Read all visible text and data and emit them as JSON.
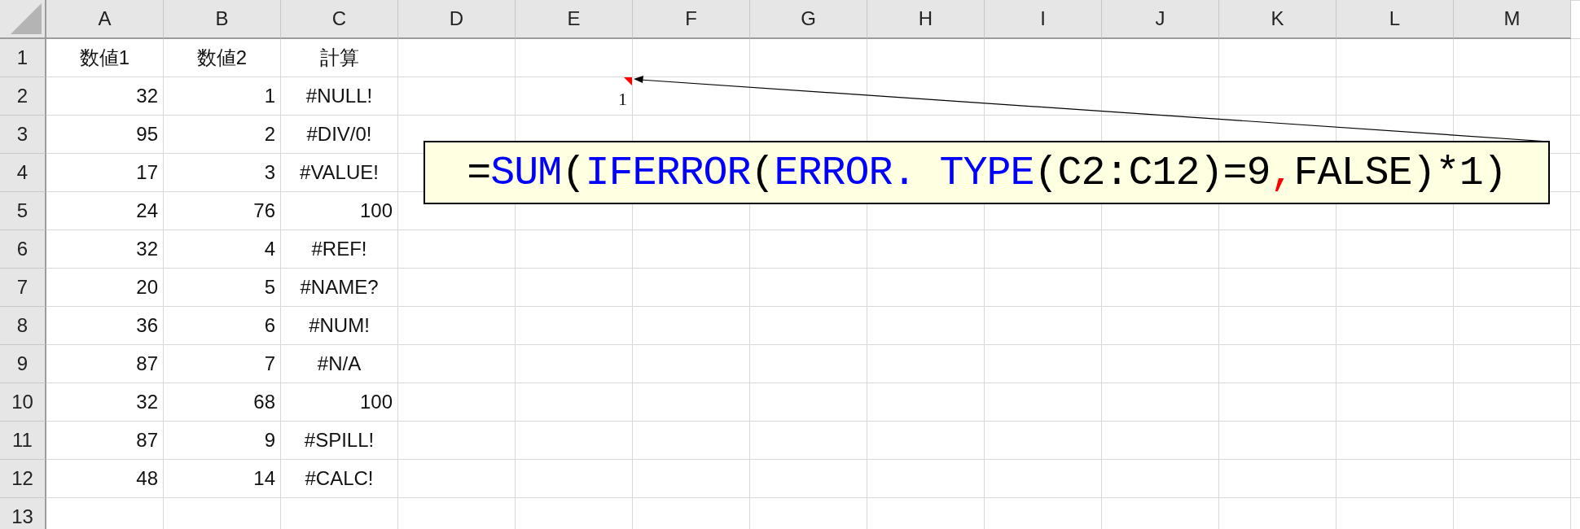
{
  "columns": [
    "A",
    "B",
    "C",
    "D",
    "E",
    "F",
    "G",
    "H",
    "I",
    "J",
    "K",
    "L",
    "M"
  ],
  "rows": [
    {
      "header": "1",
      "cells": [
        {
          "text": "数値1",
          "kind": "label"
        },
        {
          "text": "数値2",
          "kind": "label"
        },
        {
          "text": "計算",
          "kind": "label"
        }
      ]
    },
    {
      "header": "2",
      "cells": [
        {
          "text": "32",
          "kind": "number"
        },
        {
          "text": "1",
          "kind": "number"
        },
        {
          "text": "#NULL!",
          "kind": "error"
        }
      ]
    },
    {
      "header": "3",
      "cells": [
        {
          "text": "95",
          "kind": "number"
        },
        {
          "text": "2",
          "kind": "number"
        },
        {
          "text": "#DIV/0!",
          "kind": "error"
        }
      ]
    },
    {
      "header": "4",
      "cells": [
        {
          "text": "17",
          "kind": "number"
        },
        {
          "text": "3",
          "kind": "number"
        },
        {
          "text": "#VALUE!",
          "kind": "error"
        }
      ]
    },
    {
      "header": "5",
      "cells": [
        {
          "text": "24",
          "kind": "number"
        },
        {
          "text": "76",
          "kind": "number"
        },
        {
          "text": "100",
          "kind": "number"
        }
      ]
    },
    {
      "header": "6",
      "cells": [
        {
          "text": "32",
          "kind": "number"
        },
        {
          "text": "4",
          "kind": "number"
        },
        {
          "text": "#REF!",
          "kind": "error"
        }
      ]
    },
    {
      "header": "7",
      "cells": [
        {
          "text": "20",
          "kind": "number"
        },
        {
          "text": "5",
          "kind": "number"
        },
        {
          "text": "#NAME?",
          "kind": "error"
        }
      ]
    },
    {
      "header": "8",
      "cells": [
        {
          "text": "36",
          "kind": "number"
        },
        {
          "text": "6",
          "kind": "number"
        },
        {
          "text": "#NUM!",
          "kind": "error"
        }
      ]
    },
    {
      "header": "9",
      "cells": [
        {
          "text": "87",
          "kind": "number"
        },
        {
          "text": "7",
          "kind": "number"
        },
        {
          "text": "#N/A",
          "kind": "error"
        }
      ]
    },
    {
      "header": "10",
      "cells": [
        {
          "text": "32",
          "kind": "number"
        },
        {
          "text": "68",
          "kind": "number"
        },
        {
          "text": "100",
          "kind": "number"
        }
      ]
    },
    {
      "header": "11",
      "cells": [
        {
          "text": "87",
          "kind": "number"
        },
        {
          "text": "9",
          "kind": "number"
        },
        {
          "text": "#SPILL!",
          "kind": "error"
        }
      ]
    },
    {
      "header": "12",
      "cells": [
        {
          "text": "48",
          "kind": "number"
        },
        {
          "text": "14",
          "kind": "number"
        },
        {
          "text": "#CALC!",
          "kind": "error"
        }
      ]
    },
    {
      "header": "13"
    }
  ],
  "callout": {
    "anchor_value": "1",
    "segments": [
      {
        "text": "=",
        "color": "#000000"
      },
      {
        "text": "SUM",
        "color": "#0000ff"
      },
      {
        "text": "(",
        "color": "#000000"
      },
      {
        "text": "IFERROR",
        "color": "#0000ff"
      },
      {
        "text": "(",
        "color": "#000000"
      },
      {
        "text": "ERROR. TYPE",
        "color": "#0000ff"
      },
      {
        "text": "(C2:C12)=9",
        "color": "#000000"
      },
      {
        "text": ",",
        "color": "#ff0000"
      },
      {
        "text": "FALSE)*1)",
        "color": "#000000"
      }
    ]
  }
}
